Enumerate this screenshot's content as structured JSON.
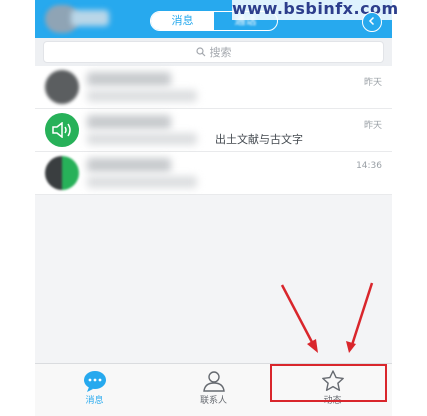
{
  "watermark": "www.bsbinfx.com",
  "header": {
    "tabs": [
      {
        "label": "消息",
        "active": true
      },
      {
        "label": "通话",
        "active": false
      }
    ],
    "accent_color": "#27a9ee"
  },
  "search": {
    "placeholder": "搜索"
  },
  "conversations": [
    {
      "time": "昨天",
      "preview": ""
    },
    {
      "time": "昨天",
      "preview": "出土文献与古文字"
    },
    {
      "time": "14:36",
      "preview": ""
    }
  ],
  "tabbar": {
    "items": [
      {
        "label": "消息",
        "icon": "chat-bubble-icon"
      },
      {
        "label": "联系人",
        "icon": "contacts-icon"
      },
      {
        "label": "动态",
        "icon": "star-icon"
      }
    ]
  },
  "annotation_color": "#d9262c"
}
